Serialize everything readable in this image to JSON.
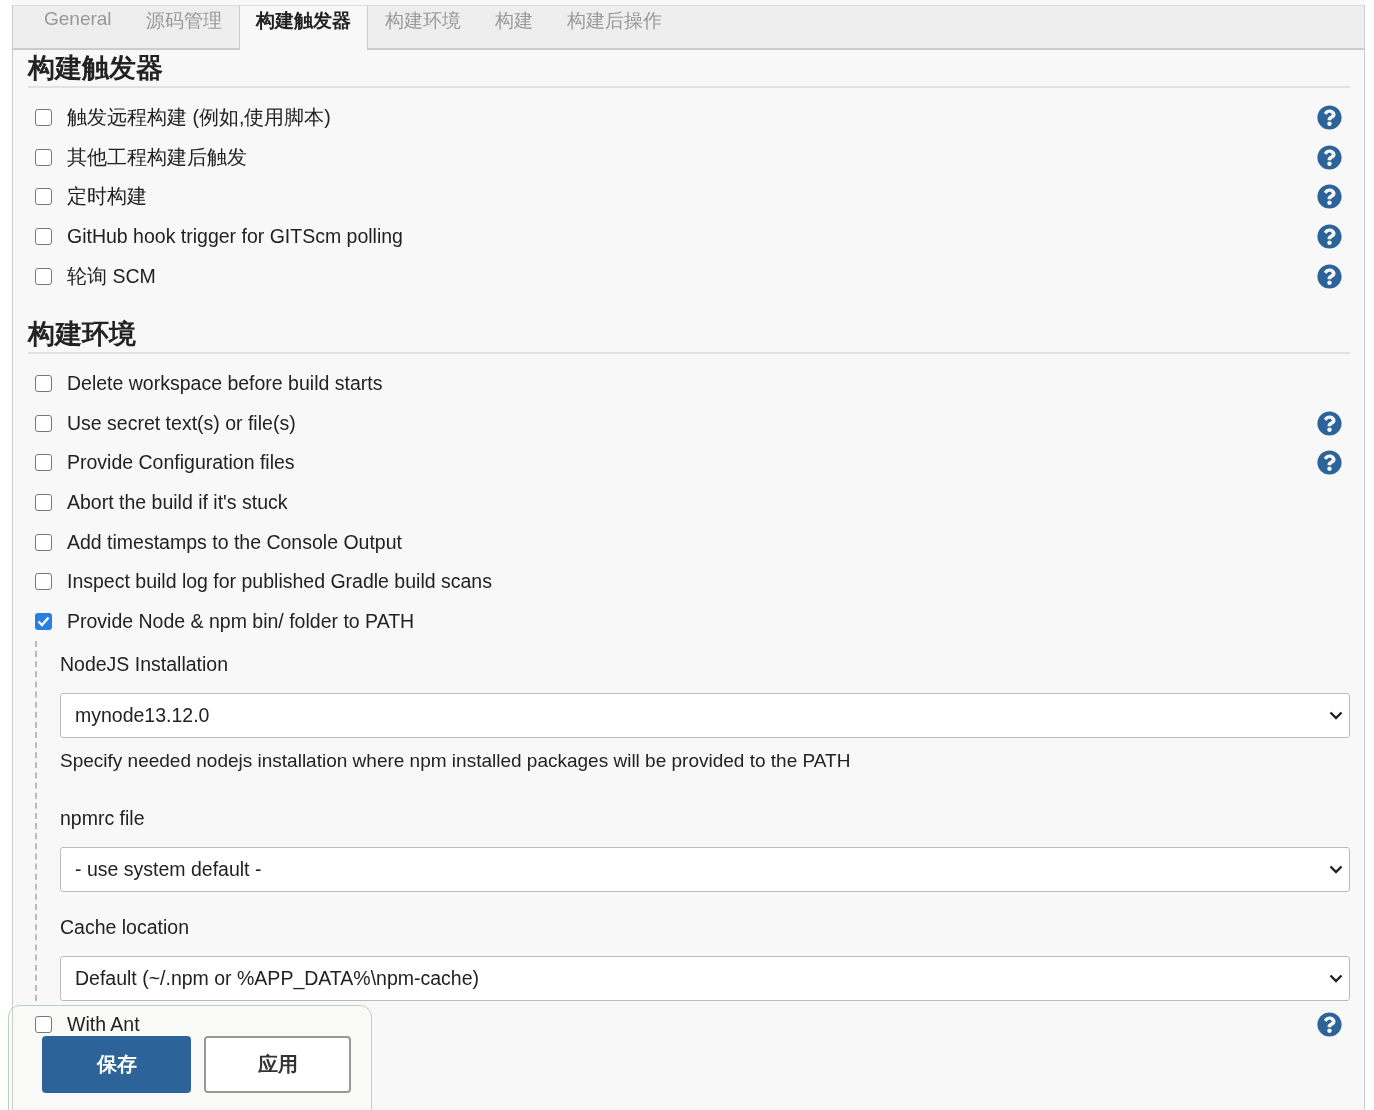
{
  "tabs": [
    {
      "label": "General",
      "selected": false
    },
    {
      "label": "源码管理",
      "selected": false
    },
    {
      "label": "构建触发器",
      "selected": true
    },
    {
      "label": "构建环境",
      "selected": false
    },
    {
      "label": "构建",
      "selected": false
    },
    {
      "label": "构建后操作",
      "selected": false
    }
  ],
  "sections": [
    {
      "title": "构建触发器",
      "items": [
        {
          "label": "触发远程构建 (例如,使用脚本)",
          "checked": false,
          "help": true
        },
        {
          "label": "其他工程构建后触发",
          "checked": false,
          "help": true
        },
        {
          "label": "定时构建",
          "checked": false,
          "help": true
        },
        {
          "label": "GitHub hook trigger for GITScm polling",
          "checked": false,
          "help": true
        },
        {
          "label": "轮询 SCM",
          "checked": false,
          "help": true
        }
      ]
    },
    {
      "title": "构建环境",
      "items": [
        {
          "label": "Delete workspace before build starts",
          "checked": false,
          "help": false
        },
        {
          "label": "Use secret text(s) or file(s)",
          "checked": false,
          "help": true
        },
        {
          "label": "Provide Configuration files",
          "checked": false,
          "help": true
        },
        {
          "label": "Abort the build if it's stuck",
          "checked": false,
          "help": false
        },
        {
          "label": "Add timestamps to the Console Output",
          "checked": false,
          "help": false
        },
        {
          "label": "Inspect build log for published Gradle build scans",
          "checked": false,
          "help": false
        },
        {
          "label": "Provide Node & npm bin/ folder to PATH",
          "checked": true,
          "help": false,
          "fields": [
            {
              "label": "NodeJS Installation",
              "value": "mynode13.12.0",
              "description": "Specify needed nodejs installation where npm installed packages will be provided to the PATH"
            },
            {
              "label": "npmrc file",
              "value": "- use system default -"
            },
            {
              "label": "Cache location",
              "value": "Default (~/.npm or %APP_DATA%\\npm-cache)"
            }
          ]
        },
        {
          "label": "With Ant",
          "checked": false,
          "help": true
        }
      ]
    }
  ],
  "buttons": {
    "save": "保存",
    "apply": "应用"
  }
}
